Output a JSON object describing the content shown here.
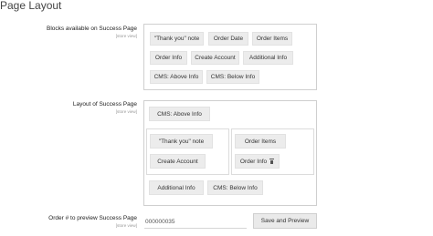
{
  "page": {
    "title": "Page Layout"
  },
  "blocks_available": {
    "label": "Blocks available on Success Page",
    "scope": "[store view]",
    "chips": [
      "\"Thank you\" note",
      "Order Date",
      "Order Items",
      "Order Info",
      "Create Account",
      "Additional Info",
      "CMS: Above Info",
      "CMS: Below Info"
    ]
  },
  "layout": {
    "label": "Layout of Success Page",
    "scope": "[store view]",
    "top_chip": "CMS: Above Info",
    "left_chips": [
      "\"Thank you\" note",
      "Create Account"
    ],
    "right_chips": [
      "Order Items",
      "Order Info"
    ],
    "bottom_chips": [
      "Additional Info",
      "CMS: Below Info"
    ]
  },
  "preview": {
    "label": "Order # to preview Success Page",
    "scope": "[store view]",
    "order_value": "000000035",
    "button_label": "Save and Preview"
  },
  "icons": {
    "delete": "trash-icon"
  }
}
